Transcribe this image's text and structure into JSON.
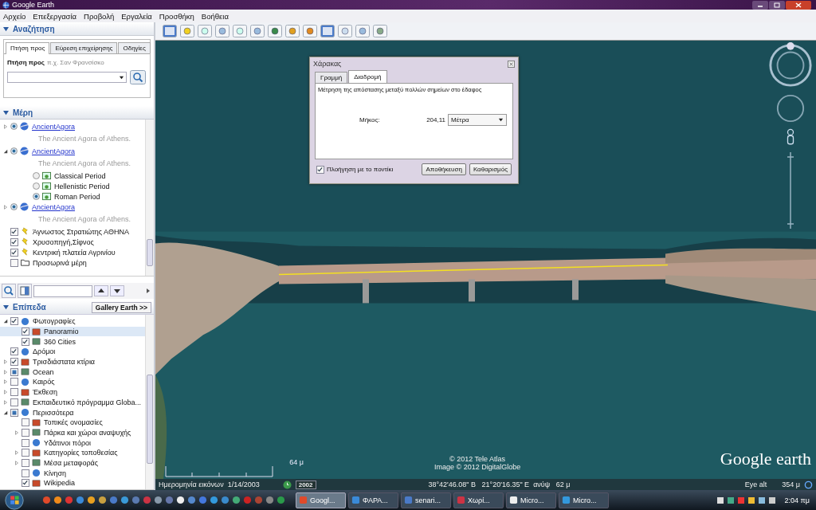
{
  "window": {
    "title": "Google Earth"
  },
  "menu": [
    "Αρχείο",
    "Επεξεργασία",
    "Προβολή",
    "Εργαλεία",
    "Προσθήκη",
    "Βοήθεια"
  ],
  "search": {
    "title": "Αναζήτηση",
    "expanded": true,
    "tabs": [
      {
        "label": "Πτήση προς",
        "selected": true
      },
      {
        "label": "Εύρεση επιχείρησης",
        "selected": false
      },
      {
        "label": "Οδηγίες",
        "selected": false
      }
    ],
    "field_label": "Πτήση προς",
    "placeholder": "π.χ. Σαν Φρανσίσκο"
  },
  "places": {
    "title": "Μέρη",
    "expanded": true,
    "items": [
      {
        "kind": "link",
        "label": "AncientAgora",
        "description": "The Ancient Agora of Athens.",
        "visible": true,
        "expanded": false
      },
      {
        "kind": "link",
        "label": "AncientAgora",
        "description": "The Ancient Agora of Athens.",
        "visible": true,
        "expanded": true,
        "children": [
          {
            "kind": "radio",
            "label": "Classical Period",
            "selected": false
          },
          {
            "kind": "radio",
            "label": "Hellenistic Period",
            "selected": false
          },
          {
            "kind": "radio",
            "label": "Roman Period",
            "selected": true
          }
        ]
      },
      {
        "kind": "link",
        "label": "AncientAgora",
        "description": "The Ancient Agora of Athens.",
        "visible": true,
        "expanded": false
      },
      {
        "kind": "check",
        "label": "Άγνωστος Στρατιώτης ΑΘΗΝΑ",
        "checked": true
      },
      {
        "kind": "check",
        "label": "Χρυσοπηγή,Σίφνος",
        "checked": true
      },
      {
        "kind": "check",
        "label": "Κεντρική πλατεία Αγρινίου",
        "checked": true
      },
      {
        "kind": "folder",
        "label": "Προσωρινά μέρη",
        "checked": false
      }
    ]
  },
  "layers": {
    "title": "Επίπεδα",
    "expanded": true,
    "gallery_button": "Gallery Earth >>",
    "items": [
      {
        "label": "Φωτογραφίες",
        "checked": true,
        "expanded": true,
        "children": [
          {
            "label": "Panoramio",
            "checked": true,
            "selected": true
          },
          {
            "label": "360 Cities",
            "checked": true,
            "selected": false
          }
        ]
      },
      {
        "label": "Δρόμοι",
        "checked": true
      },
      {
        "label": "Τρισδιάστατα κτίρια",
        "checked": true,
        "expanded": false
      },
      {
        "label": "Ocean",
        "partial": true,
        "expanded": false
      },
      {
        "label": "Καιρός",
        "checked": false,
        "expanded": false
      },
      {
        "label": "Έκθεση",
        "checked": false,
        "expanded": false
      },
      {
        "label": "Εκπαιδευτικό πρόγραμμα Globa...",
        "checked": false,
        "expanded": false
      },
      {
        "label": "Περισσότερα",
        "partial": true,
        "expanded": true,
        "children": [
          {
            "label": "Τοπικές ονομασίες",
            "checked": false
          },
          {
            "label": "Πάρκα και χώροι αναψυχής",
            "checked": false,
            "expanded": false
          },
          {
            "label": "Υδάτινοι πόροι",
            "checked": false
          },
          {
            "label": "Κατηγορίες τοποθεσίας",
            "checked": false,
            "expanded": false
          },
          {
            "label": "Μέσα μεταφοράς",
            "checked": false,
            "expanded": false
          },
          {
            "label": "Κίνηση",
            "checked": false
          },
          {
            "label": "Wikipedia",
            "checked": true
          }
        ]
      }
    ]
  },
  "ruler": {
    "title": "Χάρακας",
    "tabs": [
      {
        "label": "Γραμμή",
        "selected": false
      },
      {
        "label": "Διαδρομή",
        "selected": true
      }
    ],
    "description": "Μέτρηση της απόστασης μεταξύ πολλών σημείων στο έδαφος",
    "length_label": "Μήκος:",
    "length_value": "204,11",
    "unit": "Μέτρα",
    "mouse_navigation": {
      "label": "Πλοήγηση με το ποντίκι",
      "checked": true
    },
    "buttons": [
      "Αποθήκευση",
      "Καθαρισμός"
    ]
  },
  "map": {
    "scale_label": "64 μ",
    "attribution": [
      "© 2012 Tele Atlas",
      "Image © 2012 DigitalGlobe"
    ],
    "logo": "Google earth"
  },
  "status_bar": {
    "date_label": "Ημερομηνία εικόνων",
    "date": "1/14/2003",
    "year": "2002",
    "coordinates": "38°42'46.08\" Β   21°20'16.35\" Ε",
    "elevation": "ανύψ   62 μ",
    "eye_alt_label": "Eye alt",
    "eye_alt": "354 μ"
  },
  "taskbar": {
    "windows": [
      {
        "label": "Googl...",
        "selected": true
      },
      {
        "label": "ΦΑΡΑ...",
        "selected": false
      },
      {
        "label": "senari...",
        "selected": false
      },
      {
        "label": "Χωρί...",
        "selected": false
      },
      {
        "label": "Micro...",
        "selected": false
      },
      {
        "label": "Micro...",
        "selected": false
      }
    ],
    "clock": "2:04 πμ"
  }
}
